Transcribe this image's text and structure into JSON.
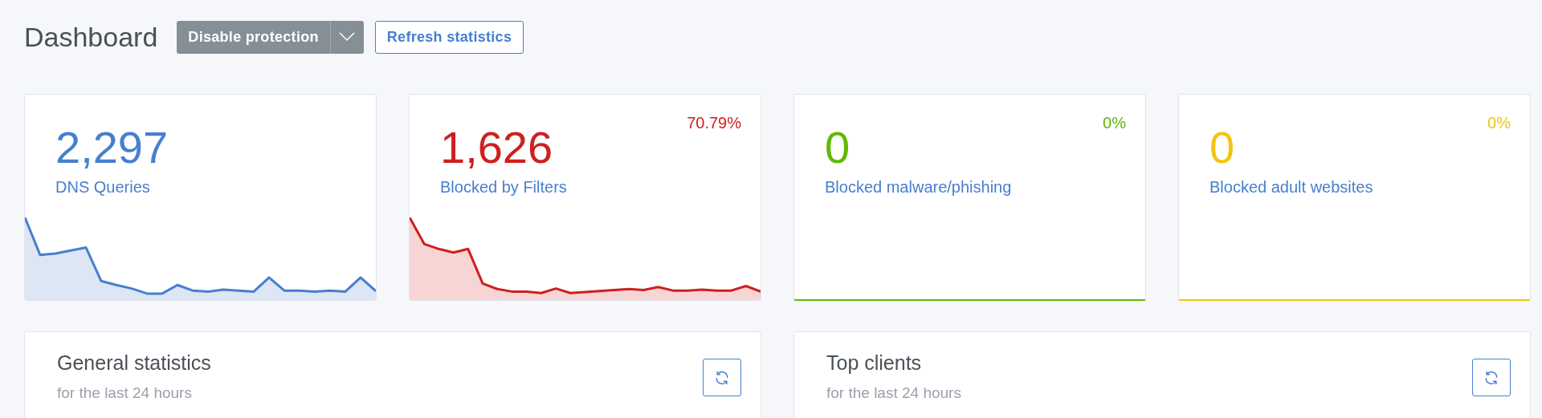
{
  "page": {
    "title": "Dashboard"
  },
  "toolbar": {
    "disable_button": "Disable protection",
    "refresh_button": "Refresh statistics"
  },
  "stat_cards": [
    {
      "kind": "sparkline",
      "value": "2,297",
      "label": "DNS Queries",
      "color": "#467fcf"
    },
    {
      "kind": "sparkline",
      "value": "1,626",
      "label": "Blocked by Filters",
      "percent": "70.79%",
      "color": "#cd201f"
    },
    {
      "kind": "bar",
      "value": "0",
      "label": "Blocked malware/phishing",
      "percent": "0%",
      "color": "#5eba00"
    },
    {
      "kind": "bar",
      "value": "0",
      "label": "Blocked adult websites",
      "percent": "0%",
      "color": "#f1c40f"
    }
  ],
  "panels": [
    {
      "title": "General statistics",
      "subtitle": "for the last 24 hours"
    },
    {
      "title": "Top clients",
      "subtitle": "for the last 24 hours"
    }
  ]
}
